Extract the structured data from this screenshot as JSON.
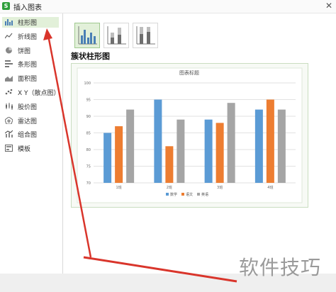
{
  "window": {
    "title": "插入图表",
    "app_icon_letter": "S"
  },
  "sidebar": {
    "items": [
      {
        "label": "柱形图",
        "icon": "column-chart-icon",
        "active": true
      },
      {
        "label": "折线图",
        "icon": "line-chart-icon"
      },
      {
        "label": "饼图",
        "icon": "pie-chart-icon"
      },
      {
        "label": "条形图",
        "icon": "bar-chart-icon"
      },
      {
        "label": "面积图",
        "icon": "area-chart-icon"
      },
      {
        "label": "X Y（散点图）",
        "icon": "scatter-chart-icon"
      },
      {
        "label": "股价图",
        "icon": "stock-chart-icon"
      },
      {
        "label": "雷达图",
        "icon": "radar-chart-icon"
      },
      {
        "label": "组合图",
        "icon": "combo-chart-icon"
      },
      {
        "label": "模板",
        "icon": "template-icon"
      }
    ]
  },
  "subtypes": [
    {
      "name": "clustered-column",
      "selected": true
    },
    {
      "name": "stacked-column"
    },
    {
      "name": "percent-stacked-column"
    }
  ],
  "section_title": "簇状柱形图",
  "chart_data": {
    "type": "bar",
    "title": "图表标题",
    "categories": [
      "1班",
      "2班",
      "3班",
      "4班"
    ],
    "series": [
      {
        "name": "数学",
        "color": "#5b9bd5",
        "values": [
          85,
          95,
          89,
          92
        ]
      },
      {
        "name": "语文",
        "color": "#ed7d31",
        "values": [
          87,
          81,
          88,
          95
        ]
      },
      {
        "name": "英语",
        "color": "#a5a5a5",
        "values": [
          92,
          89,
          94,
          92
        ]
      }
    ],
    "ylim": [
      70,
      100
    ],
    "yticks": [
      70,
      75,
      80,
      85,
      90,
      95,
      100
    ],
    "grid": true,
    "legend": "bottom",
    "xlabel": "",
    "ylabel": ""
  },
  "watermark": "软件技巧",
  "colors": {
    "accent": "#e2f0d9",
    "annotation": "#d9352b"
  }
}
